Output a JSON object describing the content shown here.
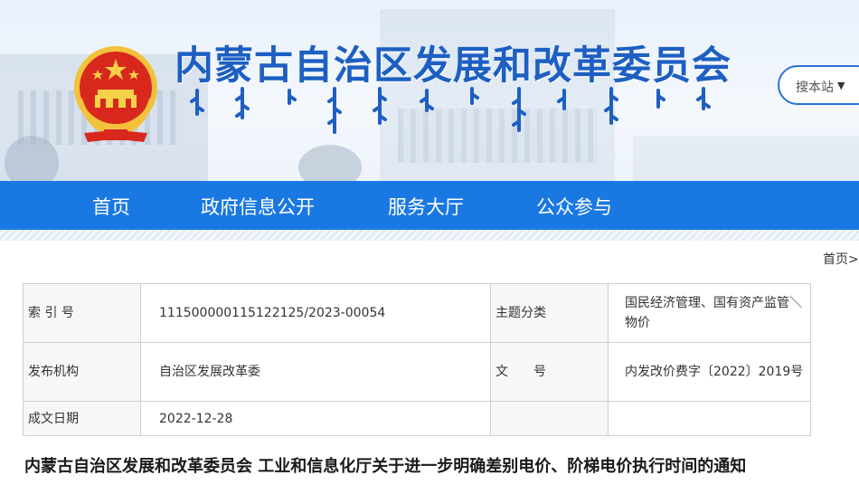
{
  "header": {
    "title": "内蒙古自治区发展和改革委员会"
  },
  "search": {
    "scope_label": "搜本站",
    "arrow": "▼"
  },
  "nav": {
    "items": [
      "首页",
      "政府信息公开",
      "服务大厅",
      "公众参与"
    ]
  },
  "breadcrumb": {
    "text": "首页>"
  },
  "meta_table": {
    "rows": [
      [
        "索 引 号",
        "11150000011512212​5/2023-00054",
        "主题分类",
        "国民经济管理、国有资产监管＼物价"
      ],
      [
        "发布机构",
        "自治区发展改革委",
        "文　　号",
        "内发改价费字〔2022〕2019号"
      ],
      [
        "成文日期",
        "2022-12-28",
        "",
        ""
      ]
    ]
  },
  "document": {
    "title": "内蒙古自治区发展和改革委员会 工业和信息化厅关于进一步明确差别电价、阶梯电价执行时间的通知"
  },
  "colors": {
    "brand_blue": "#1a78e2",
    "title_blue": "#1d5fc2"
  }
}
